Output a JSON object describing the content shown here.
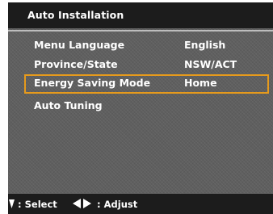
{
  "header": {
    "title": "Auto Installation"
  },
  "menu": {
    "items": [
      {
        "label": "Menu Language",
        "value": "English",
        "selected": false
      },
      {
        "label": "Province/State",
        "value": "NSW/ACT",
        "selected": false
      },
      {
        "label": "Energy Saving Mode",
        "value": "Home",
        "selected": true
      },
      {
        "label": "Auto Tuning",
        "value": "",
        "selected": false
      }
    ]
  },
  "footer": {
    "select_label": ": Select",
    "adjust_label": ": Adjust",
    "select_icon": "up-down-arrows-icon",
    "adjust_icon": "left-right-arrows-icon"
  },
  "colors": {
    "panel_background": "#5f5f5f",
    "bar_background": "#1c1c1c",
    "highlight_border": "#e69a1c",
    "text": "#ffffff"
  }
}
